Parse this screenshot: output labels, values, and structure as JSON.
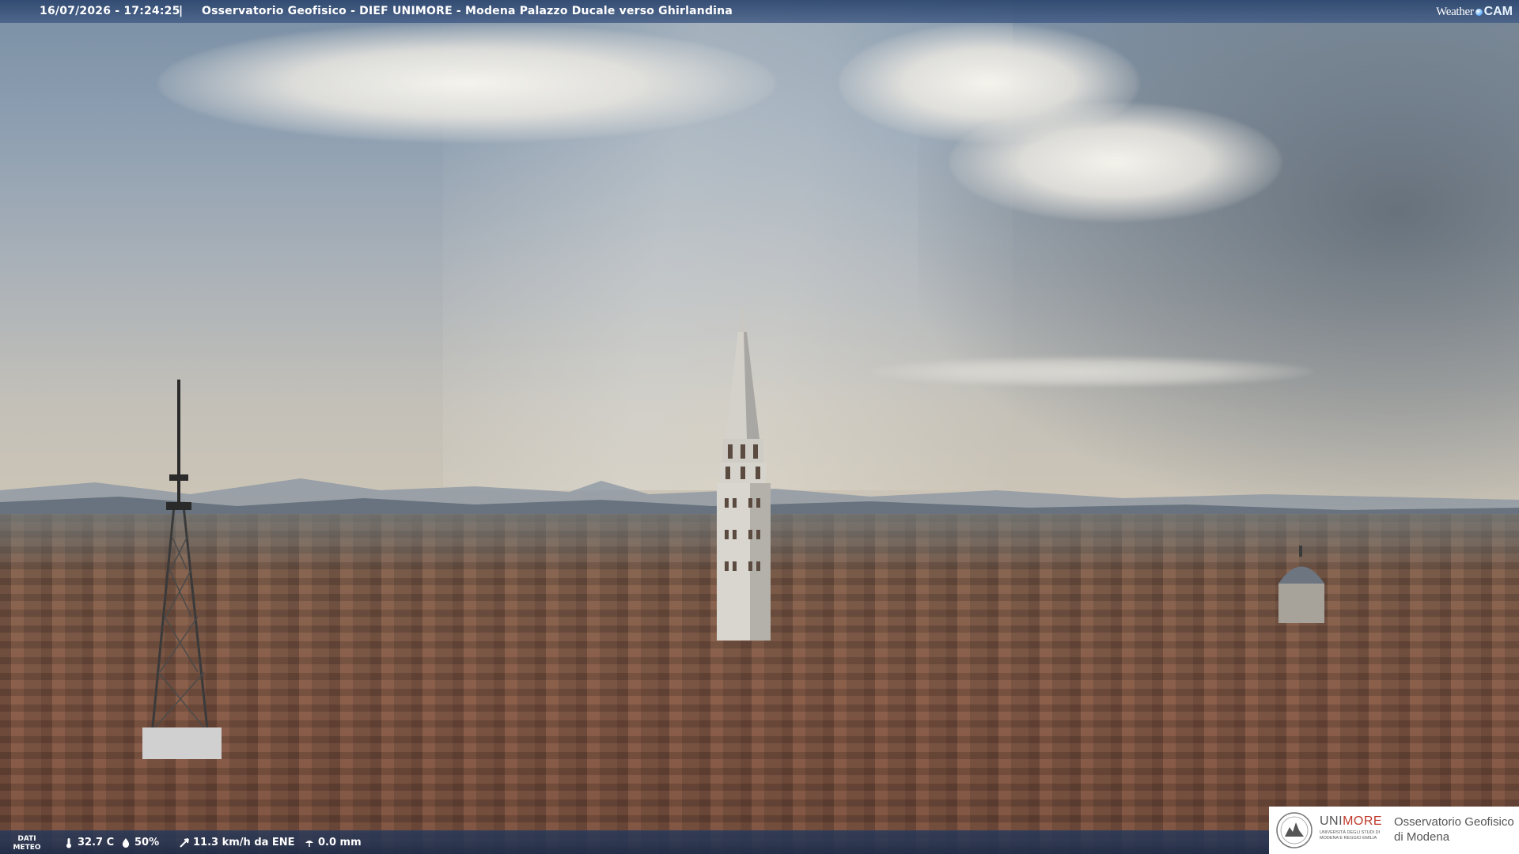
{
  "header": {
    "timestamp": "16/07/2026 - 17:24:25",
    "separator": "|",
    "location_title": "Osservatorio Geofisico - DIEF UNIMORE - Modena Palazzo Ducale verso Ghirlandina",
    "brand_weather": "Weather",
    "brand_cam": "CAM"
  },
  "weather": {
    "label_line1": "DATI",
    "label_line2": "METEO",
    "temperature": "32.7 C",
    "humidity": "50%",
    "wind": "11.3 km/h da ENE",
    "rain": "0.0 mm"
  },
  "logo": {
    "uni": "UNI",
    "more": "MORE",
    "university_line1": "UNIVERSITÀ DEGLI STUDI DI",
    "university_line2": "MODENA E REGGIO EMILIA",
    "observatory_line1": "Osservatorio Geofisico",
    "observatory_line2": "di Modena"
  },
  "colors": {
    "bar_blue": "#2d466e",
    "unimore_red": "#c0392b"
  }
}
